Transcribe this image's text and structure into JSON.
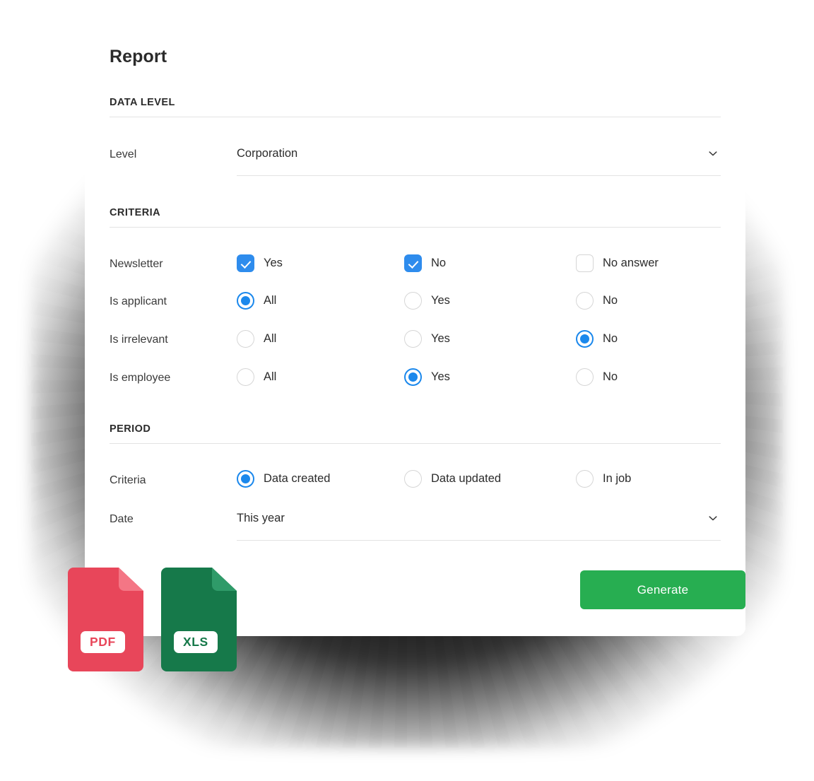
{
  "page": {
    "title": "Report"
  },
  "sections": {
    "data_level": {
      "header": "DATA LEVEL",
      "level_label": "Level",
      "level_value": "Corporation"
    },
    "criteria": {
      "header": "CRITERIA",
      "rows": [
        {
          "label": "Newsletter",
          "type": "checkbox",
          "options": [
            {
              "label": "Yes",
              "checked": true
            },
            {
              "label": "No",
              "checked": true
            },
            {
              "label": "No answer",
              "checked": false
            }
          ]
        },
        {
          "label": "Is applicant",
          "type": "radio",
          "options": [
            {
              "label": "All",
              "checked": true
            },
            {
              "label": "Yes",
              "checked": false
            },
            {
              "label": "No",
              "checked": false
            }
          ]
        },
        {
          "label": "Is irrelevant",
          "type": "radio",
          "options": [
            {
              "label": "All",
              "checked": false
            },
            {
              "label": "Yes",
              "checked": false
            },
            {
              "label": "No",
              "checked": true
            }
          ]
        },
        {
          "label": "Is employee",
          "type": "radio",
          "options": [
            {
              "label": "All",
              "checked": false
            },
            {
              "label": "Yes",
              "checked": true
            },
            {
              "label": "No",
              "checked": false
            }
          ]
        }
      ]
    },
    "period": {
      "header": "PERIOD",
      "criteria_label": "Criteria",
      "criteria_options": [
        {
          "label": "Data created",
          "checked": true
        },
        {
          "label": "Data updated",
          "checked": false
        },
        {
          "label": "In job",
          "checked": false
        }
      ],
      "date_label": "Date",
      "date_value": "This year"
    }
  },
  "footer": {
    "formats": [
      {
        "name": "pdf-file-icon",
        "tag": "PDF",
        "body_color": "#e8465a",
        "fold_color": "#f47685",
        "text_color": "#e8465a"
      },
      {
        "name": "xls-file-icon",
        "tag": "XLS",
        "body_color": "#16794a",
        "fold_color": "#2f9b69",
        "text_color": "#16794a"
      }
    ],
    "generate_label": "Generate"
  },
  "colors": {
    "accent_blue": "#2e8ced",
    "radio_blue": "#1b88ec",
    "generate_green": "#27ae51",
    "divider": "#e3e3e3",
    "text": "#2b2b2b"
  },
  "icons": {
    "chevron_down": "chevron-down-icon"
  }
}
